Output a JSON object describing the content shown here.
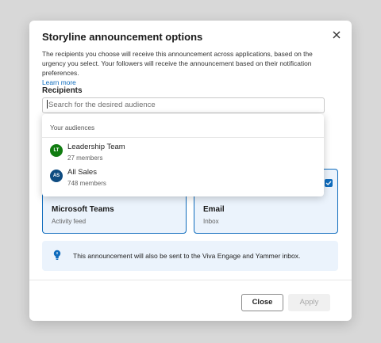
{
  "dialog": {
    "title": "Storyline announcement options",
    "description": "The recipients you choose will receive this announcement across applications, based on the urgency you select. Your followers will receive the announcement based on their notification preferences.",
    "learn_more": "Learn more",
    "recipients_label": "Recipients",
    "search_placeholder": "Search for the desired audience"
  },
  "dropdown": {
    "header": "Your audiences",
    "items": [
      {
        "initials": "LT",
        "name": "Leadership Team",
        "meta": "27 members",
        "color": "#107c10"
      },
      {
        "initials": "AS",
        "name": "All Sales",
        "meta": "748 members",
        "color": "#0f4c81"
      }
    ]
  },
  "channels": [
    {
      "title": "Microsoft Teams",
      "subtitle": "Activity feed"
    },
    {
      "title": "Email",
      "subtitle": "Inbox"
    }
  ],
  "info": {
    "text": "This announcement will also be sent to the Viva Engage and Yammer inbox."
  },
  "footer": {
    "close_label": "Close",
    "apply_label": "Apply"
  },
  "colors": {
    "accent": "#0f6cbd",
    "card_bg": "#ebf3fc"
  }
}
